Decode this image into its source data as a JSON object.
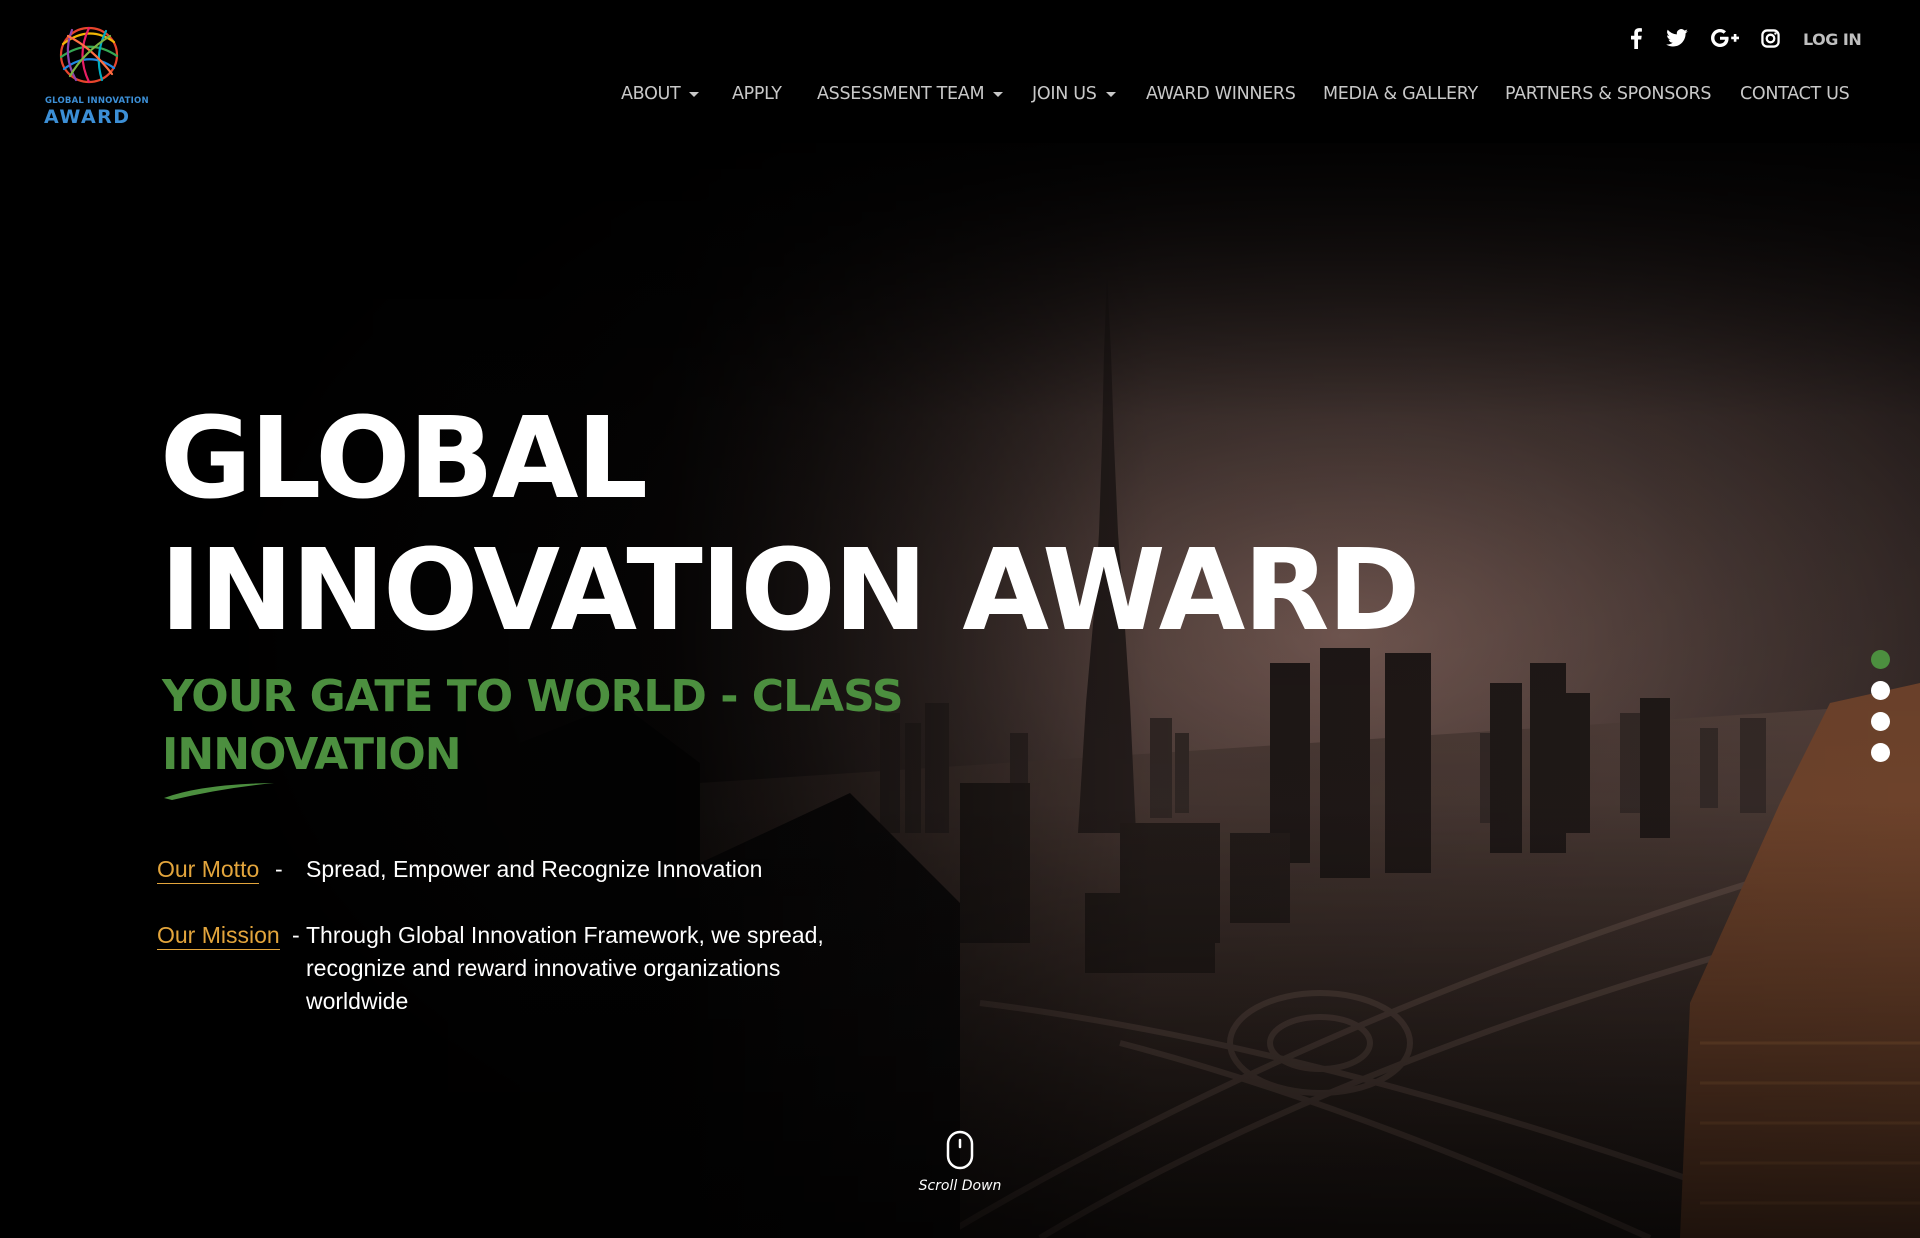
{
  "logo": {
    "small_text": "GLOBAL INNOVATION",
    "big_text": "AWARD"
  },
  "social": {
    "icons": [
      "facebook-icon",
      "twitter-icon",
      "google-plus-icon",
      "instagram-icon"
    ],
    "login_label": "LOG IN"
  },
  "nav": {
    "items": [
      {
        "label": "ABOUT",
        "dropdown": true
      },
      {
        "label": "APPLY",
        "dropdown": false
      },
      {
        "label": "ASSESSMENT TEAM",
        "dropdown": true
      },
      {
        "label": "JOIN US",
        "dropdown": true
      },
      {
        "label": "AWARD WINNERS",
        "dropdown": false
      },
      {
        "label": "MEDIA & GALLERY",
        "dropdown": false
      },
      {
        "label": "PARTNERS & SPONSORS",
        "dropdown": false
      },
      {
        "label": "CONTACT US",
        "dropdown": false
      }
    ]
  },
  "hero": {
    "title_line1": "GLOBAL",
    "title_line2": "INNOVATION AWARD",
    "subtitle": "YOUR GATE TO WORLD - CLASS INNOVATION",
    "motto_label": "Our Motto",
    "motto_dash": "-",
    "motto_text": "Spread, Empower and Recognize Innovation",
    "mission_label": "Our Mission",
    "mission_dash": "-",
    "mission_text": "Through Global Innovation Framework, we spread, recognize and reward innovative organizations worldwide",
    "slider_dot_count": 4,
    "slider_active_index": 0,
    "scroll_label": "Scroll Down"
  },
  "colors": {
    "background": "#000000",
    "nav_text": "#c8c8c8",
    "subtitle_green": "#4c8f3f",
    "link_gold": "#e3a53c",
    "logo_blue": "#3c8fd6",
    "active_dot": "#4c8f3f"
  }
}
